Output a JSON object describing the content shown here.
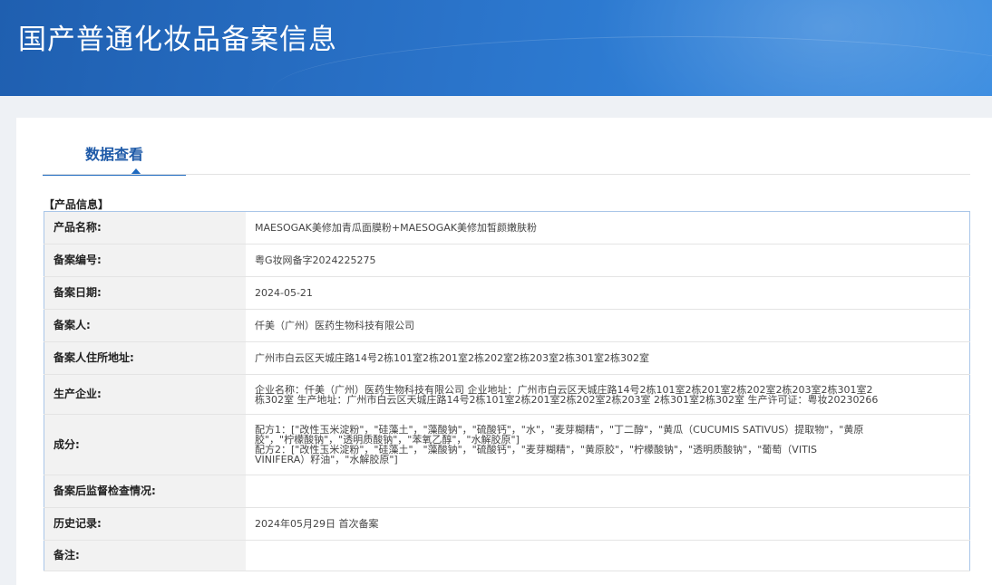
{
  "banner": {
    "title": "国产普通化妆品备案信息"
  },
  "tab": {
    "label": "数据查看"
  },
  "section": {
    "title": "【产品信息】"
  },
  "rows": [
    {
      "key": "产品名称:",
      "value": "MAESOGAK美修加青瓜面膜粉+MAESOGAK美修加皙颜嫩肤粉"
    },
    {
      "key": "备案编号:",
      "value": "粤G妆网备字2024225275"
    },
    {
      "key": "备案日期:",
      "value": "2024-05-21"
    },
    {
      "key": "备案人:",
      "value": "仟美（广州）医药生物科技有限公司"
    },
    {
      "key": "备案人住所地址:",
      "value": "广州市白云区天城庄路14号2栋101室2栋201室2栋202室2栋203室2栋301室2栋302室"
    },
    {
      "key": "生产企业:",
      "value": "企业名称：仟美（广州）医药生物科技有限公司 企业地址：广州市白云区天城庄路14号2栋101室2栋201室2栋202室2栋203室2栋301室2\n栋302室 生产地址：广州市白云区天城庄路14号2栋101室2栋201室2栋202室2栋203室 2栋301室2栋302室 生产许可证：粤妆20230266"
    },
    {
      "key": "成分:",
      "value": "配方1：[\"改性玉米淀粉\"，\"硅藻土\"，\"藻酸钠\"，\"硫酸钙\"，\"水\"，\"麦芽糊精\"，\"丁二醇\"，\"黄瓜（CUCUMIS SATIVUS）提取物\"，\"黄原\n胶\"，\"柠檬酸钠\"，\"透明质酸钠\"，\"苯氧乙醇\"，\"水解胶原\"]\n配方2：[\"改性玉米淀粉\"，\"硅藻土\"，\"藻酸钠\"，\"硫酸钙\"，\"麦芽糊精\"，\"黄原胶\"，\"柠檬酸钠\"，\"透明质酸钠\"，\"葡萄（VITIS\nVINIFERA）籽油\"，\"水解胶原\"]"
    },
    {
      "key": "备案后监督检查情况:",
      "value": ""
    },
    {
      "key": "历史记录:",
      "value": "2024年05月29日 首次备案"
    },
    {
      "key": "备注:",
      "value": ""
    }
  ],
  "colors": {
    "banner": "#2a73c9",
    "accent": "#1e6ac0",
    "key_bg": "#f2f2f2",
    "table_border": "#a9c6e8"
  }
}
